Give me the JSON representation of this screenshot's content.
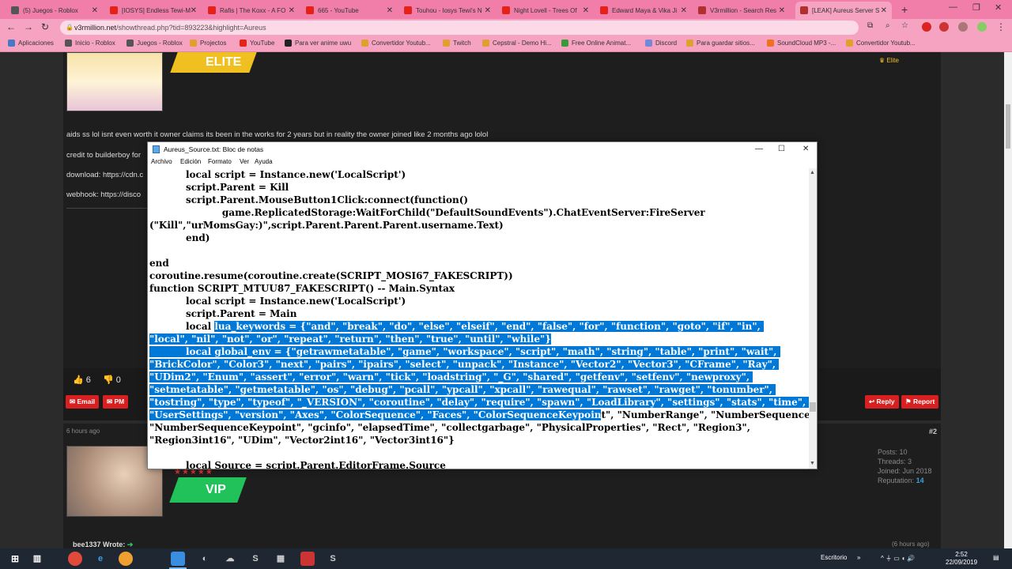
{
  "browser": {
    "tabs": [
      {
        "title": "(5) Juegos - Roblox",
        "color": "#555555"
      },
      {
        "title": "[IOSYS] Endless Tewi-M",
        "color": "#e62117"
      },
      {
        "title": "Rafis | The Koxx - A FO",
        "color": "#e62117"
      },
      {
        "title": "665 - YouTube",
        "color": "#e62117"
      },
      {
        "title": "Touhou - Iosys Tewi's N",
        "color": "#e62117"
      },
      {
        "title": "Night Lovell - Trees Of",
        "color": "#e62117"
      },
      {
        "title": "Edward Maya & Vika Ji",
        "color": "#e62117"
      },
      {
        "title": "V3rmillion - Search Res",
        "color": "#b03030"
      },
      {
        "title": "[LEAK] Aureus Server S",
        "color": "#b03030"
      }
    ],
    "url_host": "v3rmillion.net",
    "url_path": "/showthread.php?tid=893223&highlight=Aureus",
    "bookmarks": [
      {
        "label": "Aplicaciones",
        "color": "#4a78c8"
      },
      {
        "label": "Inicio - Roblox",
        "color": "#555555"
      },
      {
        "label": "Juegos - Roblox",
        "color": "#555555"
      },
      {
        "label": "Projectos",
        "color": "#e0a030"
      },
      {
        "label": "YouTube",
        "color": "#e62117"
      },
      {
        "label": "Para ver anime uwu",
        "color": "#222222"
      },
      {
        "label": "Convertidor Youtub...",
        "color": "#e0a030"
      },
      {
        "label": "Twitch",
        "color": "#e0a030"
      },
      {
        "label": "Cepstral - Demo Hi...",
        "color": "#e0a030"
      },
      {
        "label": "Free Online Animat...",
        "color": "#3a9a3a"
      },
      {
        "label": "Discord",
        "color": "#7289da"
      },
      {
        "label": "Para guardar sitios...",
        "color": "#e0a030"
      },
      {
        "label": "SoundCloud MP3 -...",
        "color": "#f07020"
      },
      {
        "label": "Convertidor Youtub...",
        "color": "#e0a030"
      }
    ]
  },
  "post1": {
    "rank": "ELITE",
    "rank_small": "Elite",
    "lines": [
      "aids ss lol isnt even worth it owner claims its been in the works for 2 years but in reality the owner joined like 2 months ago lolol",
      "credit to builderboy for",
      "download: https://cdn.c",
      "webhook: https://disco"
    ],
    "likes": "6",
    "dislikes": "0",
    "buttons": {
      "email": "Email",
      "pm": "PM",
      "reply": "Reply",
      "report": "Report"
    }
  },
  "post2": {
    "time": "6 hours ago",
    "number": "#2",
    "rank": "VIP",
    "stats": {
      "posts": "Posts: 10",
      "threads": "Threads: 3",
      "joined": "Joined: Jun 2018",
      "reputation_label": "Reputation:",
      "reputation_value": "14"
    },
    "quote": "bee1337 Wrote:",
    "quote_time": "(6 hours ago)"
  },
  "notepad": {
    "title": "Aureus_Source.txt: Bloc de notas",
    "menu": [
      "Archivo",
      "Edición",
      "Formato",
      "Ver",
      "Ayuda"
    ],
    "lines": [
      [
        {
          "t": "           local script = Instance.new('LocalScript')"
        }
      ],
      [
        {
          "t": "           script.Parent = Kill"
        }
      ],
      [
        {
          "t": "           script.Parent.MouseButton1Click:connect(function()"
        }
      ],
      [
        {
          "t": "                      game.ReplicatedStorage:WaitForChild(\"DefaultSoundEvents\").ChatEventServer:FireServer"
        }
      ],
      [
        {
          "t": "(\"Kill\",\"urMomsGay:)\",script.Parent.Parent.Parent.username.Text)"
        }
      ],
      [
        {
          "t": "           end)"
        }
      ],
      [
        {
          "t": ""
        }
      ],
      [
        {
          "t": "end"
        }
      ],
      [
        {
          "t": "coroutine.resume(coroutine.create(SCRIPT_MOSI67_FAKESCRIPT))"
        }
      ],
      [
        {
          "t": "function SCRIPT_MTUU87_FAKESCRIPT() -- Main.Syntax"
        }
      ],
      [
        {
          "t": "           local script = Instance.new('LocalScript')"
        }
      ],
      [
        {
          "t": "           script.Parent = Main"
        }
      ],
      [
        {
          "t": "           local "
        },
        {
          "t": "lua_keywords = {\"and\", \"break\", \"do\", \"else\", \"elseif\", \"end\", \"false\", \"for\", \"function\", \"goto\", \"if\", \"in\", ",
          "s": true
        }
      ],
      [
        {
          "t": "\"local\", \"nil\", \"not\", \"or\", \"repeat\", \"return\", \"then\", \"true\", \"until\", \"while\"}",
          "s": true
        }
      ],
      [
        {
          "t": "           local global_env = {\"getrawmetatable\", \"game\", \"workspace\", \"script\", \"math\", \"string\", \"table\", \"print\", \"wait\", ",
          "s": true
        }
      ],
      [
        {
          "t": "\"BrickColor\", \"Color3\", \"next\", \"pairs\", \"ipairs\", \"select\", \"unpack\", \"Instance\", \"Vector2\", \"Vector3\", \"CFrame\", \"Ray\", ",
          "s": true
        }
      ],
      [
        {
          "t": "\"UDim2\", \"Enum\", \"assert\", \"error\", \"warn\", \"tick\", \"loadstring\", \"_G\", \"shared\", \"getfenv\", \"setfenv\", \"newproxy\", ",
          "s": true
        }
      ],
      [
        {
          "t": "\"setmetatable\", \"getmetatable\", \"os\", \"debug\", \"pcall\", \"ypcall\", \"xpcall\", \"rawequal\", \"rawset\", \"rawget\", \"tonumber\", ",
          "s": true
        }
      ],
      [
        {
          "t": "\"tostring\", \"type\", \"typeof\", \"_VERSION\", \"coroutine\", \"delay\", \"require\", \"spawn\", \"LoadLibrary\", \"settings\", \"stats\", \"time\", ",
          "s": true
        }
      ],
      [
        {
          "t": "\"UserSettings\", \"version\", \"Axes\", \"ColorSequence\", \"Faces\", \"ColorSequenceKeypoin",
          "s": true
        },
        {
          "t": "t\", \"NumberRange\", \"NumberSequence\", "
        }
      ],
      [
        {
          "t": "\"NumberSequenceKeypoint\", \"gcinfo\", \"elapsedTime\", \"collectgarbage\", \"PhysicalProperties\", \"Rect\", \"Region3\", "
        }
      ],
      [
        {
          "t": "\"Region3int16\", \"UDim\", \"Vector2int16\", \"Vector3int16\"}"
        }
      ],
      [
        {
          "t": ""
        }
      ],
      [
        {
          "t": "           local Source = script.Parent.EditorFrame.Source"
        }
      ]
    ]
  },
  "taskbar": {
    "desktop_label": "Escritorio",
    "time": "2:52",
    "date": "22/09/2019"
  }
}
